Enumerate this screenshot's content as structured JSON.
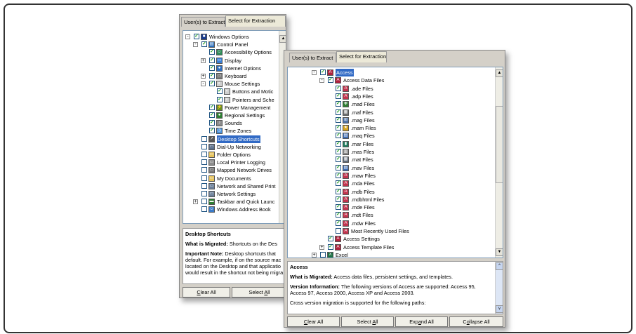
{
  "back": {
    "tabs": [
      "User(s) to Extract",
      "Select for Extraction"
    ],
    "tree": [
      {
        "label": "Windows Options",
        "level": 0,
        "exp": "-",
        "icon": "windows-icon",
        "color": "#1a3d8f",
        "glyph": "■",
        "checked": true
      },
      {
        "label": "Control Panel",
        "level": 1,
        "exp": "-",
        "icon": "control-panel-icon",
        "color": "#2a6ebb",
        "glyph": "▤",
        "checked": true
      },
      {
        "label": "Accessibility Options",
        "level": 2,
        "exp": "",
        "icon": "accessibility-icon",
        "color": "#2e8b57",
        "glyph": "☺",
        "checked": true
      },
      {
        "label": "Display",
        "level": 2,
        "exp": "+",
        "icon": "display-icon",
        "color": "#3a7fd5",
        "glyph": "▭",
        "checked": true
      },
      {
        "label": "Internet Options",
        "level": 2,
        "exp": "",
        "icon": "internet-icon",
        "color": "#2f6fc0",
        "glyph": "●",
        "checked": true
      },
      {
        "label": "Keyboard",
        "level": 2,
        "exp": "+",
        "icon": "keyboard-icon",
        "color": "#7b7b7b",
        "glyph": "▭",
        "checked": true
      },
      {
        "label": "Mouse Settings",
        "level": 2,
        "exp": "-",
        "icon": "mouse-icon",
        "color": "#cfcfcf",
        "glyph": "◐",
        "checked": true
      },
      {
        "label": "Buttons and Motic",
        "level": 3,
        "exp": "",
        "icon": "mouse-icon",
        "color": "#cfcfcf",
        "glyph": "◐",
        "checked": true
      },
      {
        "label": "Pointers and Sche",
        "level": 3,
        "exp": "",
        "icon": "mouse-icon",
        "color": "#cfcfcf",
        "glyph": "◐",
        "checked": true
      },
      {
        "label": "Power Management",
        "level": 2,
        "exp": "",
        "icon": "power-icon",
        "color": "#6b8e23",
        "glyph": "⚡",
        "checked": true
      },
      {
        "label": "Regional Settings",
        "level": 2,
        "exp": "",
        "icon": "globe-icon",
        "color": "#2e7d32",
        "glyph": "●",
        "checked": true
      },
      {
        "label": "Sounds",
        "level": 2,
        "exp": "",
        "icon": "sound-icon",
        "color": "#8a8a8a",
        "glyph": "♪",
        "checked": true
      },
      {
        "label": "Time Zones",
        "level": 2,
        "exp": "",
        "icon": "clock-icon",
        "color": "#4a90d9",
        "glyph": "◷",
        "checked": true
      },
      {
        "label": "Desktop Shortcuts",
        "level": 1,
        "exp": "",
        "icon": "shortcut-icon",
        "color": "#555555",
        "glyph": "↗",
        "checked": false,
        "selected": true
      },
      {
        "label": "Dial-Up Networking",
        "level": 1,
        "exp": "",
        "icon": "dialup-icon",
        "color": "#5b6f8a",
        "glyph": "▭",
        "checked": false
      },
      {
        "label": "Folder Options",
        "level": 1,
        "exp": "",
        "icon": "folder-icon",
        "color": "#e6c35c",
        "glyph": "▭",
        "checked": false
      },
      {
        "label": "Local Printer Logging",
        "level": 1,
        "exp": "",
        "icon": "printer-icon",
        "color": "#8c8c8c",
        "glyph": "▭",
        "checked": false
      },
      {
        "label": "Mapped Network Drives",
        "level": 1,
        "exp": "",
        "icon": "network-drive-icon",
        "color": "#7a7a7a",
        "glyph": "▭",
        "checked": false
      },
      {
        "label": "My Documents",
        "level": 1,
        "exp": "",
        "icon": "folder-icon",
        "color": "#e6c35c",
        "glyph": "▭",
        "checked": false
      },
      {
        "label": "Network and Shared Print",
        "level": 1,
        "exp": "",
        "icon": "network-icon",
        "color": "#6b7f99",
        "glyph": "▭",
        "checked": false
      },
      {
        "label": "Network Settings",
        "level": 1,
        "exp": "",
        "icon": "network-icon",
        "color": "#6b7f99",
        "glyph": "▭",
        "checked": false
      },
      {
        "label": "Taskbar and Quick Launc",
        "level": 1,
        "exp": "+",
        "icon": "taskbar-icon",
        "color": "#2e7d32",
        "glyph": "▬",
        "checked": false
      },
      {
        "label": "Windows Address Book",
        "level": 1,
        "exp": "",
        "icon": "address-book-icon",
        "color": "#3b7bc8",
        "glyph": "☺",
        "checked": false
      }
    ],
    "desc": {
      "title": "Desktop Shortcuts",
      "migrated_label": "What is Migrated:",
      "migrated_text": " Shortcuts on the Des",
      "note_label": "Important Note:",
      "note_text": " Desktop shortcuts that default.  For example, if on the source mac located on the Desktop and that applicatio would result in the shortcut not being migra"
    },
    "buttons": {
      "clear": "Clear All",
      "select": "Select All"
    }
  },
  "front": {
    "tabs": [
      "User(s) to Extract",
      "Select for Extraction"
    ],
    "tree": [
      {
        "label": "Access",
        "level": 0,
        "exp": "-",
        "icon": "access-icon",
        "color": "#b0213d",
        "glyph": "A",
        "checked": true,
        "selected": true
      },
      {
        "label": "Access Data Files",
        "level": 1,
        "exp": "-",
        "icon": "access-icon",
        "color": "#b0213d",
        "glyph": "A",
        "checked": true
      },
      {
        "label": ".ade Files",
        "level": 2,
        "icon": "access-file-icon",
        "color": "#c2334d",
        "glyph": "A",
        "checked": true
      },
      {
        "label": ".adp Files",
        "level": 2,
        "icon": "access-file-icon",
        "color": "#c2334d",
        "glyph": "A",
        "checked": true
      },
      {
        "label": ".mad Files",
        "level": 2,
        "icon": "module-icon",
        "color": "#2e7d32",
        "glyph": "✤",
        "checked": true
      },
      {
        "label": ".maf Files",
        "level": 2,
        "icon": "form-icon",
        "color": "#6d6d6d",
        "glyph": "▦",
        "checked": true
      },
      {
        "label": ".mag Files",
        "level": 2,
        "icon": "diagram-icon",
        "color": "#4a6fa5",
        "glyph": "⊞",
        "checked": true
      },
      {
        "label": ".mam Files",
        "level": 2,
        "icon": "macro-icon",
        "color": "#d8a520",
        "glyph": "★",
        "checked": true
      },
      {
        "label": ".maq Files",
        "level": 2,
        "icon": "query-icon",
        "color": "#3d6cb3",
        "glyph": "▤",
        "checked": true
      },
      {
        "label": ".mar Files",
        "level": 2,
        "icon": "report-icon",
        "color": "#1f7a5c",
        "glyph": "▮",
        "checked": true
      },
      {
        "label": ".mas Files",
        "level": 2,
        "icon": "procedure-icon",
        "color": "#8a8a8a",
        "glyph": "▥",
        "checked": true
      },
      {
        "label": ".mat Files",
        "level": 2,
        "icon": "table-icon",
        "color": "#5f6b7a",
        "glyph": "▦",
        "checked": true
      },
      {
        "label": ".mav Files",
        "level": 2,
        "icon": "view-icon",
        "color": "#3d6cb3",
        "glyph": "▤",
        "checked": true
      },
      {
        "label": ".maw Files",
        "level": 2,
        "icon": "page-icon",
        "color": "#c2334d",
        "glyph": "A",
        "checked": true
      },
      {
        "label": ".mda Files",
        "level": 2,
        "icon": "access-file-icon",
        "color": "#c2334d",
        "glyph": "A",
        "checked": true
      },
      {
        "label": ".mdb Files",
        "level": 2,
        "icon": "access-file-icon",
        "color": "#c2334d",
        "glyph": "A",
        "checked": true
      },
      {
        "label": ".mdbhtml Files",
        "level": 2,
        "icon": "access-web-icon",
        "color": "#c2334d",
        "glyph": "A",
        "checked": true
      },
      {
        "label": ".mde Files",
        "level": 2,
        "icon": "access-file-icon",
        "color": "#c2334d",
        "glyph": "A",
        "checked": true
      },
      {
        "label": ".mdt Files",
        "level": 2,
        "icon": "access-file-icon",
        "color": "#c2334d",
        "glyph": "A",
        "checked": true
      },
      {
        "label": ".mdw Files",
        "level": 2,
        "icon": "workgroup-icon",
        "color": "#c2334d",
        "glyph": "A",
        "checked": true
      },
      {
        "label": "Most Recently Used Files",
        "level": 2,
        "icon": "access-file-icon",
        "color": "#c2334d",
        "glyph": "A",
        "checked": false
      },
      {
        "label": "Access Settings",
        "level": 1,
        "exp": "",
        "icon": "access-icon",
        "color": "#b0213d",
        "glyph": "A",
        "checked": true
      },
      {
        "label": "Access Template Files",
        "level": 1,
        "exp": "+",
        "icon": "access-icon",
        "color": "#b0213d",
        "glyph": "A",
        "checked": true
      },
      {
        "label": "Excel",
        "level": 0,
        "exp": "+",
        "icon": "excel-icon",
        "color": "#1e7145",
        "glyph": "X",
        "checked": false
      }
    ],
    "desc": {
      "title": "Access",
      "migrated_label": "What is Migrated:",
      "migrated_text": " Access data files, persistent settings, and templates.",
      "version_label": "Version Information:",
      "version_text": " The following versions of Access are supported: Access 95, Access 97, Access 2000, Access XP and Access 2003.",
      "cross_text": "Cross version migration is supported for the following paths:"
    },
    "buttons": {
      "clear": "Clear All",
      "select": "Select All",
      "expand": "Expand All",
      "collapse": "Collapse All"
    }
  }
}
